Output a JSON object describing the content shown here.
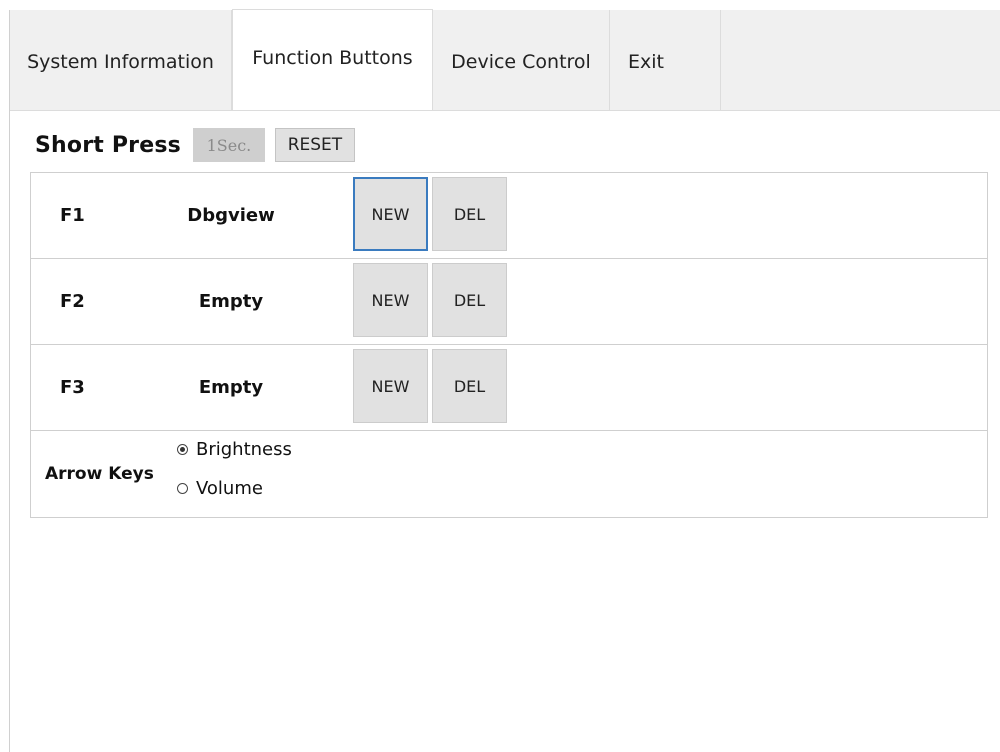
{
  "tabs": [
    {
      "label": "System Information",
      "active": false
    },
    {
      "label": "Function Buttons",
      "active": true
    },
    {
      "label": "Device Control",
      "active": false
    },
    {
      "label": "Exit",
      "active": false
    }
  ],
  "header": {
    "title": "Short Press",
    "duration_label": "1Sec.",
    "reset_label": "RESET"
  },
  "functions": [
    {
      "key": "F1",
      "name": "Dbgview",
      "new_label": "NEW",
      "del_label": "DEL"
    },
    {
      "key": "F2",
      "name": "Empty",
      "new_label": "NEW",
      "del_label": "DEL"
    },
    {
      "key": "F3",
      "name": "Empty",
      "new_label": "NEW",
      "del_label": "DEL"
    }
  ],
  "arrow_keys": {
    "label": "Arrow Keys",
    "options": [
      {
        "label": "Brightness",
        "selected": true
      },
      {
        "label": "Volume",
        "selected": false
      }
    ]
  },
  "colors": {
    "tab_bar_bg": "#f0f0f0",
    "button_bg": "#e1e1e1",
    "focus_border": "#3a7bbf",
    "disabled_text": "#8a8a8a"
  }
}
